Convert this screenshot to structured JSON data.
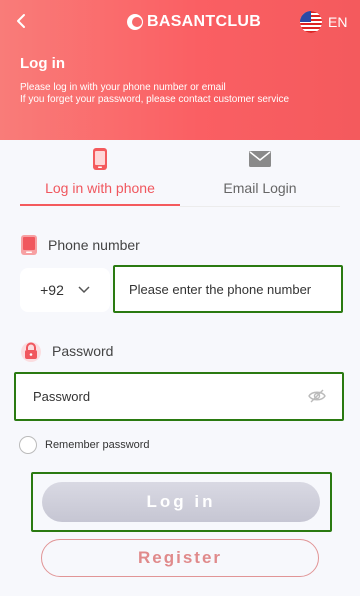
{
  "header": {
    "brand": "BASANTCLUB",
    "language": "EN",
    "title": "Log in",
    "subtitle_line1": "Please log in with your phone number or email",
    "subtitle_line2": "If you forget your password, please contact customer service"
  },
  "tabs": [
    {
      "label": "Log in with phone",
      "icon": "phone-icon",
      "active": true
    },
    {
      "label": "Email Login",
      "icon": "envelope-icon",
      "active": false
    }
  ],
  "phone": {
    "label": "Phone number",
    "country_code": "+92",
    "placeholder": "Please enter the phone number"
  },
  "password": {
    "label": "Password",
    "placeholder": "Password"
  },
  "remember_label": "Remember password",
  "login_label": "Log in",
  "register_label": "Register",
  "colors": {
    "accent": "#f45a5d",
    "highlight_border": "#2a7a11"
  }
}
